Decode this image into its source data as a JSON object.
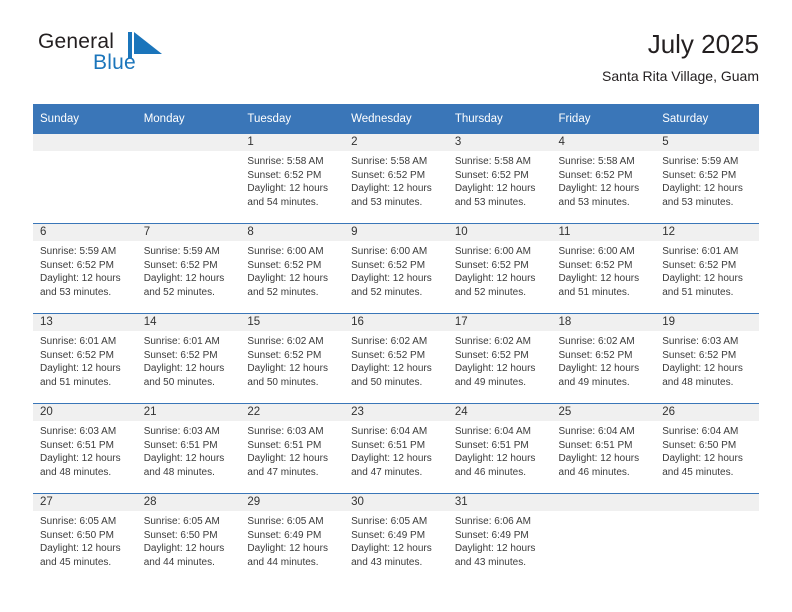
{
  "brand": {
    "name_part1": "General",
    "name_part2": "Blue",
    "mark": "flag-triangle-icon",
    "accent_color": "#1b75bb"
  },
  "header": {
    "title": "July 2025",
    "subtitle": "Santa Rita Village, Guam"
  },
  "theme": {
    "header_blue": "#3a76b8",
    "daynum_band": "#f0f0f0",
    "text": "#3b3b3b"
  },
  "calendar": {
    "weekday_headers": [
      "Sunday",
      "Monday",
      "Tuesday",
      "Wednesday",
      "Thursday",
      "Friday",
      "Saturday"
    ],
    "weeks": [
      [
        {
          "day": "",
          "lines": []
        },
        {
          "day": "",
          "lines": []
        },
        {
          "day": "1",
          "lines": [
            "Sunrise: 5:58 AM",
            "Sunset: 6:52 PM",
            "Daylight: 12 hours",
            "and 54 minutes."
          ]
        },
        {
          "day": "2",
          "lines": [
            "Sunrise: 5:58 AM",
            "Sunset: 6:52 PM",
            "Daylight: 12 hours",
            "and 53 minutes."
          ]
        },
        {
          "day": "3",
          "lines": [
            "Sunrise: 5:58 AM",
            "Sunset: 6:52 PM",
            "Daylight: 12 hours",
            "and 53 minutes."
          ]
        },
        {
          "day": "4",
          "lines": [
            "Sunrise: 5:58 AM",
            "Sunset: 6:52 PM",
            "Daylight: 12 hours",
            "and 53 minutes."
          ]
        },
        {
          "day": "5",
          "lines": [
            "Sunrise: 5:59 AM",
            "Sunset: 6:52 PM",
            "Daylight: 12 hours",
            "and 53 minutes."
          ]
        }
      ],
      [
        {
          "day": "6",
          "lines": [
            "Sunrise: 5:59 AM",
            "Sunset: 6:52 PM",
            "Daylight: 12 hours",
            "and 53 minutes."
          ]
        },
        {
          "day": "7",
          "lines": [
            "Sunrise: 5:59 AM",
            "Sunset: 6:52 PM",
            "Daylight: 12 hours",
            "and 52 minutes."
          ]
        },
        {
          "day": "8",
          "lines": [
            "Sunrise: 6:00 AM",
            "Sunset: 6:52 PM",
            "Daylight: 12 hours",
            "and 52 minutes."
          ]
        },
        {
          "day": "9",
          "lines": [
            "Sunrise: 6:00 AM",
            "Sunset: 6:52 PM",
            "Daylight: 12 hours",
            "and 52 minutes."
          ]
        },
        {
          "day": "10",
          "lines": [
            "Sunrise: 6:00 AM",
            "Sunset: 6:52 PM",
            "Daylight: 12 hours",
            "and 52 minutes."
          ]
        },
        {
          "day": "11",
          "lines": [
            "Sunrise: 6:00 AM",
            "Sunset: 6:52 PM",
            "Daylight: 12 hours",
            "and 51 minutes."
          ]
        },
        {
          "day": "12",
          "lines": [
            "Sunrise: 6:01 AM",
            "Sunset: 6:52 PM",
            "Daylight: 12 hours",
            "and 51 minutes."
          ]
        }
      ],
      [
        {
          "day": "13",
          "lines": [
            "Sunrise: 6:01 AM",
            "Sunset: 6:52 PM",
            "Daylight: 12 hours",
            "and 51 minutes."
          ]
        },
        {
          "day": "14",
          "lines": [
            "Sunrise: 6:01 AM",
            "Sunset: 6:52 PM",
            "Daylight: 12 hours",
            "and 50 minutes."
          ]
        },
        {
          "day": "15",
          "lines": [
            "Sunrise: 6:02 AM",
            "Sunset: 6:52 PM",
            "Daylight: 12 hours",
            "and 50 minutes."
          ]
        },
        {
          "day": "16",
          "lines": [
            "Sunrise: 6:02 AM",
            "Sunset: 6:52 PM",
            "Daylight: 12 hours",
            "and 50 minutes."
          ]
        },
        {
          "day": "17",
          "lines": [
            "Sunrise: 6:02 AM",
            "Sunset: 6:52 PM",
            "Daylight: 12 hours",
            "and 49 minutes."
          ]
        },
        {
          "day": "18",
          "lines": [
            "Sunrise: 6:02 AM",
            "Sunset: 6:52 PM",
            "Daylight: 12 hours",
            "and 49 minutes."
          ]
        },
        {
          "day": "19",
          "lines": [
            "Sunrise: 6:03 AM",
            "Sunset: 6:52 PM",
            "Daylight: 12 hours",
            "and 48 minutes."
          ]
        }
      ],
      [
        {
          "day": "20",
          "lines": [
            "Sunrise: 6:03 AM",
            "Sunset: 6:51 PM",
            "Daylight: 12 hours",
            "and 48 minutes."
          ]
        },
        {
          "day": "21",
          "lines": [
            "Sunrise: 6:03 AM",
            "Sunset: 6:51 PM",
            "Daylight: 12 hours",
            "and 48 minutes."
          ]
        },
        {
          "day": "22",
          "lines": [
            "Sunrise: 6:03 AM",
            "Sunset: 6:51 PM",
            "Daylight: 12 hours",
            "and 47 minutes."
          ]
        },
        {
          "day": "23",
          "lines": [
            "Sunrise: 6:04 AM",
            "Sunset: 6:51 PM",
            "Daylight: 12 hours",
            "and 47 minutes."
          ]
        },
        {
          "day": "24",
          "lines": [
            "Sunrise: 6:04 AM",
            "Sunset: 6:51 PM",
            "Daylight: 12 hours",
            "and 46 minutes."
          ]
        },
        {
          "day": "25",
          "lines": [
            "Sunrise: 6:04 AM",
            "Sunset: 6:51 PM",
            "Daylight: 12 hours",
            "and 46 minutes."
          ]
        },
        {
          "day": "26",
          "lines": [
            "Sunrise: 6:04 AM",
            "Sunset: 6:50 PM",
            "Daylight: 12 hours",
            "and 45 minutes."
          ]
        }
      ],
      [
        {
          "day": "27",
          "lines": [
            "Sunrise: 6:05 AM",
            "Sunset: 6:50 PM",
            "Daylight: 12 hours",
            "and 45 minutes."
          ]
        },
        {
          "day": "28",
          "lines": [
            "Sunrise: 6:05 AM",
            "Sunset: 6:50 PM",
            "Daylight: 12 hours",
            "and 44 minutes."
          ]
        },
        {
          "day": "29",
          "lines": [
            "Sunrise: 6:05 AM",
            "Sunset: 6:49 PM",
            "Daylight: 12 hours",
            "and 44 minutes."
          ]
        },
        {
          "day": "30",
          "lines": [
            "Sunrise: 6:05 AM",
            "Sunset: 6:49 PM",
            "Daylight: 12 hours",
            "and 43 minutes."
          ]
        },
        {
          "day": "31",
          "lines": [
            "Sunrise: 6:06 AM",
            "Sunset: 6:49 PM",
            "Daylight: 12 hours",
            "and 43 minutes."
          ]
        },
        {
          "day": "",
          "lines": []
        },
        {
          "day": "",
          "lines": []
        }
      ]
    ]
  }
}
